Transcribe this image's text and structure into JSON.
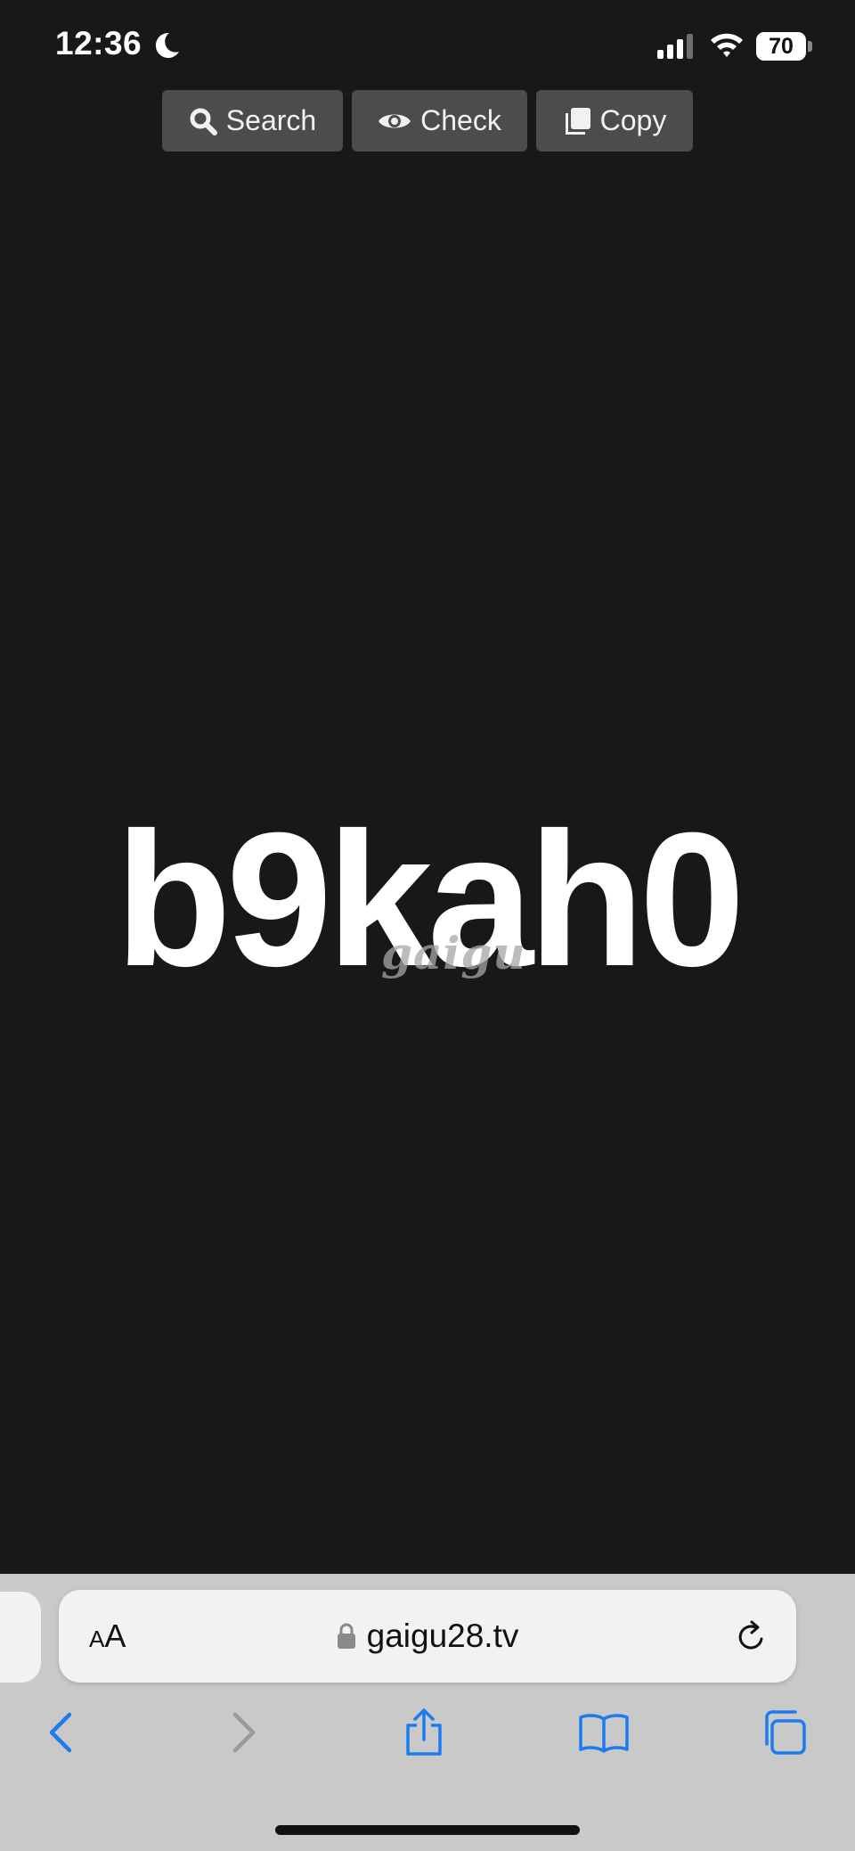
{
  "status_bar": {
    "time": "12:36",
    "battery_percent": "70",
    "icons": [
      "moon-icon",
      "signal-icon",
      "wifi-icon",
      "battery-icon"
    ]
  },
  "toolbar": {
    "search_label": "Search",
    "check_label": "Check",
    "copy_label": "Copy",
    "icons": [
      "search-icon",
      "eye-icon",
      "copy-icon"
    ]
  },
  "main": {
    "code": "b9kah0",
    "watermark": "gaigu"
  },
  "browser": {
    "aa_small": "A",
    "aa_big": "A",
    "url": "gaigu28.tv",
    "icons": [
      "lock-icon",
      "reload-icon",
      "back-icon",
      "forward-icon",
      "share-icon",
      "bookmarks-icon",
      "tabs-icon"
    ]
  },
  "colors": {
    "background": "#181818",
    "button": "#4c4c4c",
    "safari_bar": "#c9c9c9",
    "accent_blue": "#1a7cf0",
    "disabled_gray": "#9a9a9a"
  }
}
